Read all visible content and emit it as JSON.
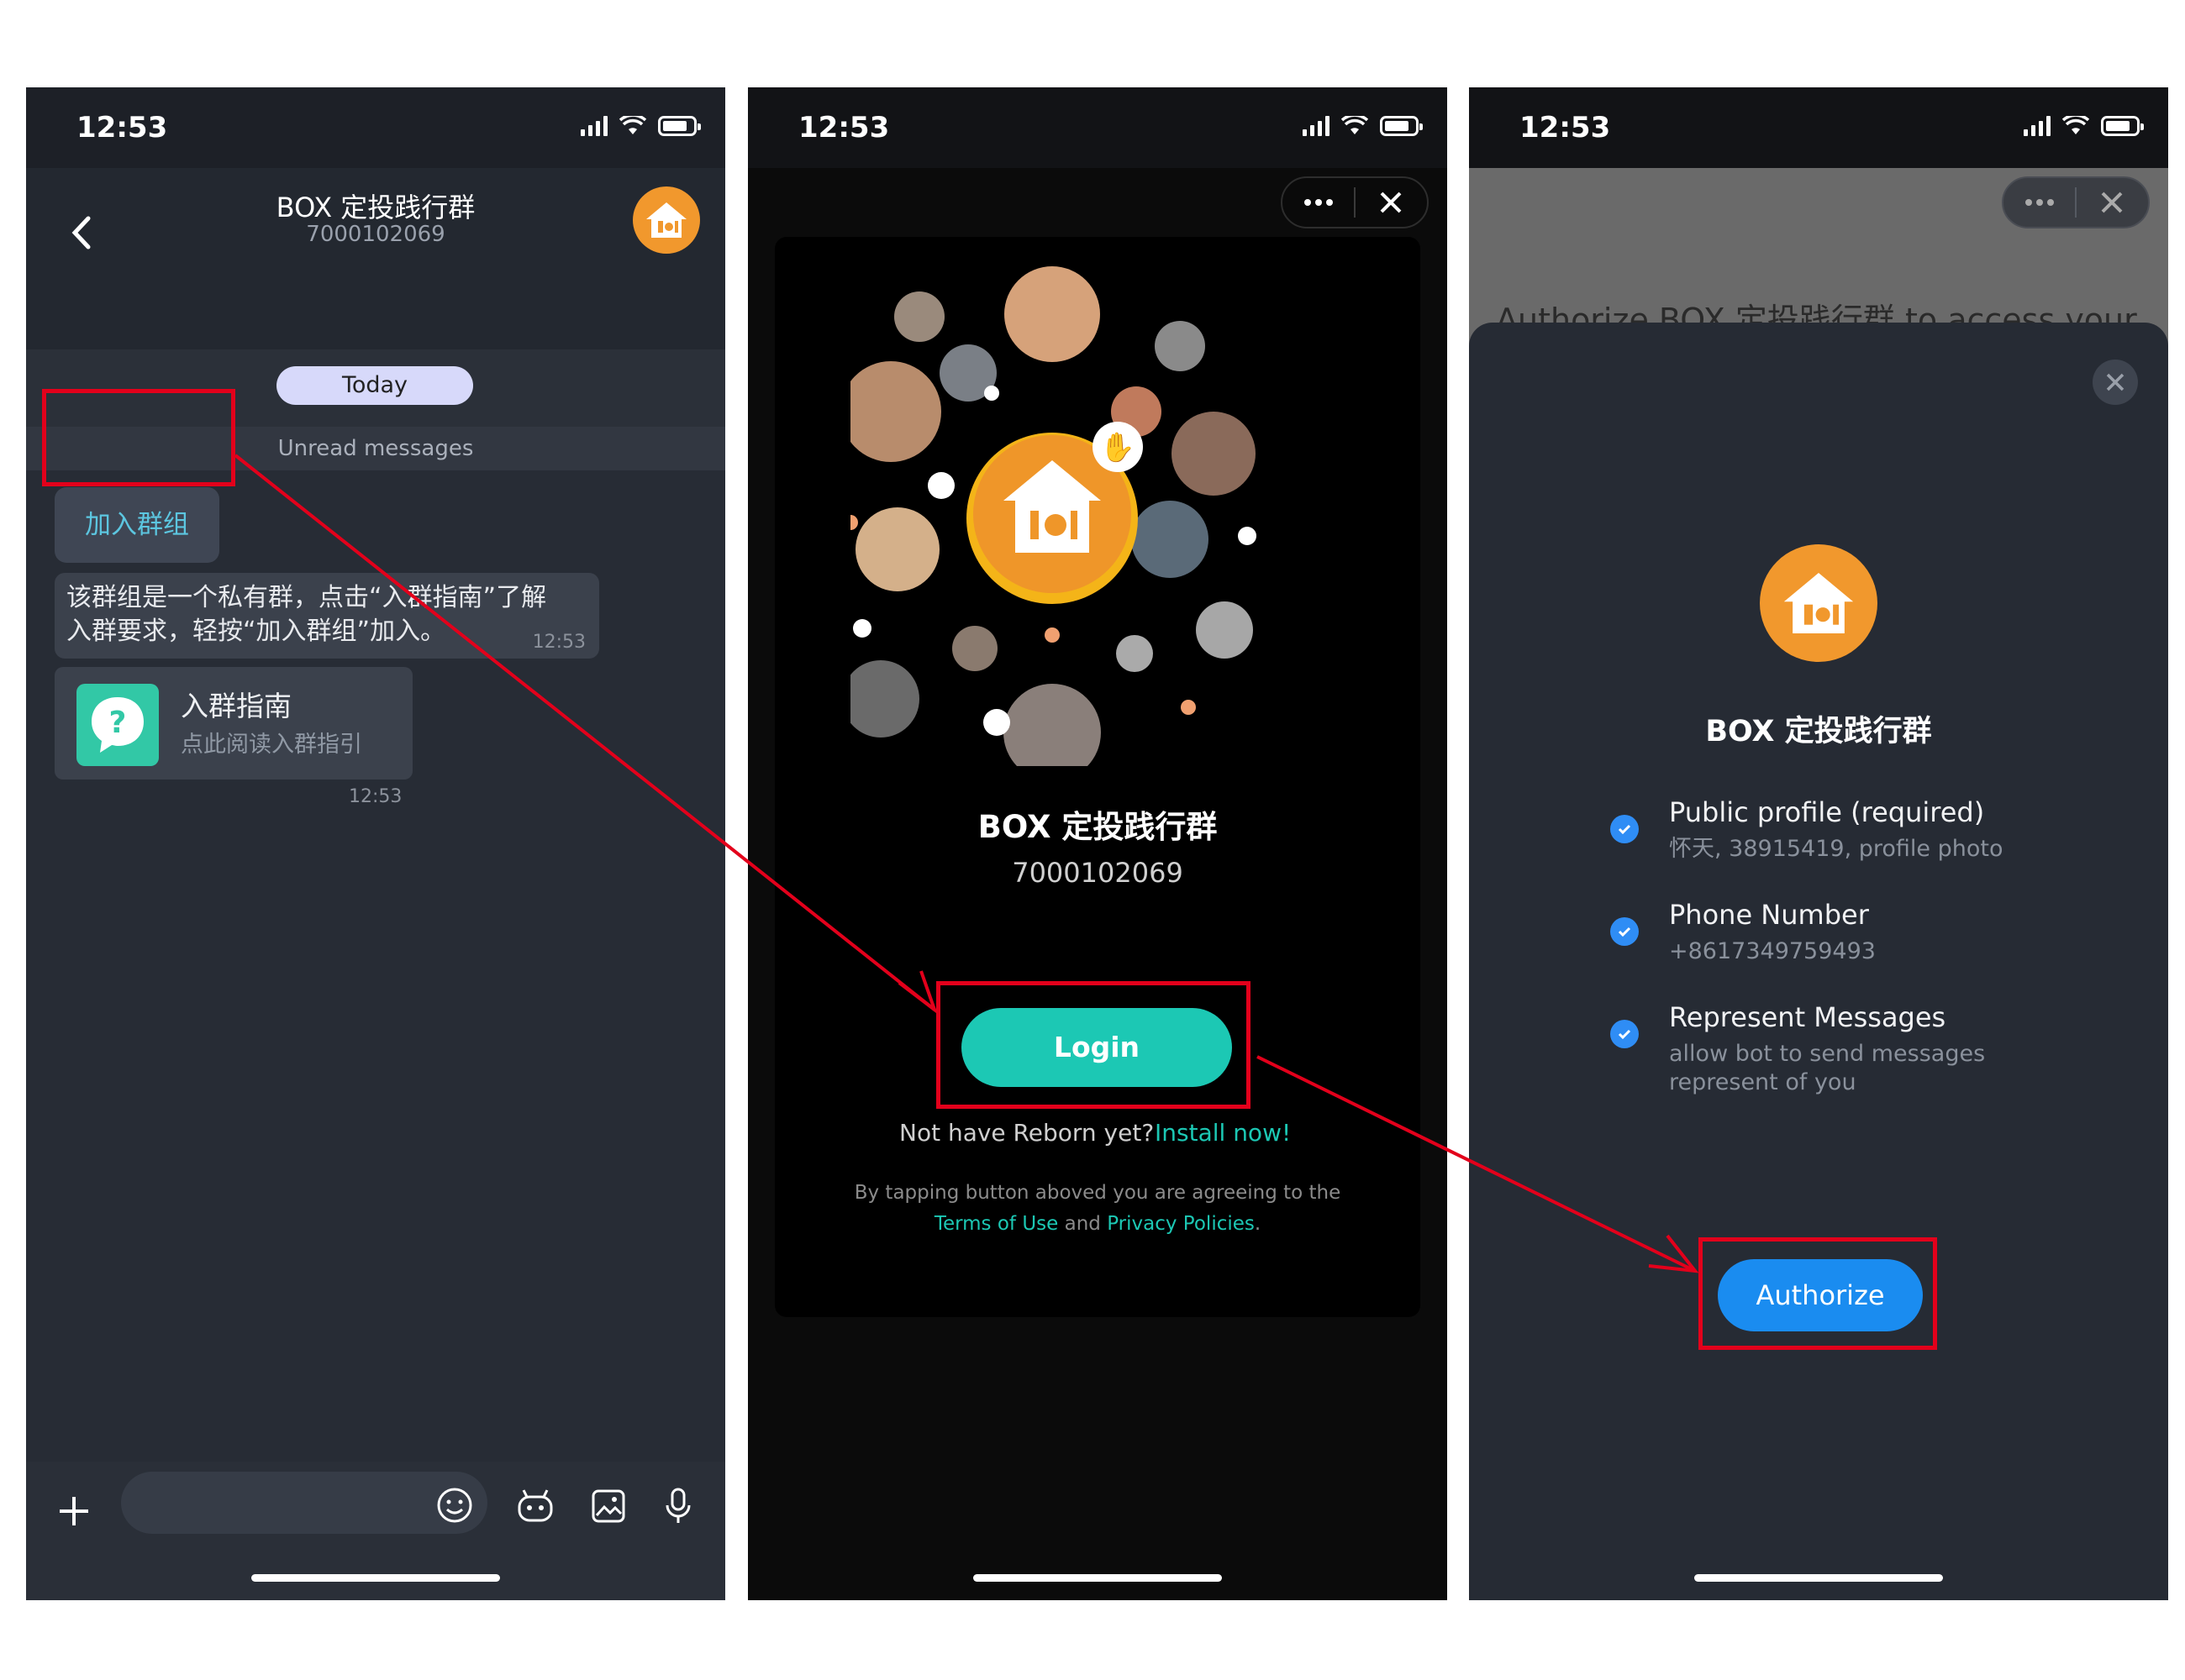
{
  "status": {
    "time": "12:53"
  },
  "chat": {
    "title": "BOX 定投践行群",
    "group_id": "7000102069",
    "date_label": "Today",
    "unread_label": "Unread messages",
    "join_button": "加入群组",
    "message_line1": "该群组是一个私有群，点击“入群指南”了解",
    "message_line2": "入群要求，轻按“加入群组”加入。",
    "message_time": "12:53",
    "card_title": "入群指南",
    "card_subtitle": "点此阅读入群指引",
    "card_time": "12:53"
  },
  "login": {
    "group_title": "BOX 定投践行群",
    "group_id": "7000102069",
    "login_button": "Login",
    "not_have_text": "Not have Reborn yet?",
    "install_link": "Install now!",
    "terms_prefix": "By tapping button aboved you are agreeing to the",
    "terms_link": "Terms of Use",
    "terms_and": "and",
    "privacy_link": "Privacy Policies",
    "terms_suffix": "."
  },
  "authorize": {
    "backdrop_text": "Authorize BOX 定投践行群 to access your",
    "title": "BOX 定投践行群",
    "permissions": [
      {
        "title": "Public profile (required)",
        "subtitle": "怀天, 38915419, profile photo"
      },
      {
        "title": "Phone Number",
        "subtitle": "+8617349759493"
      },
      {
        "title": "Represent Messages",
        "subtitle": "allow bot to send messages",
        "subtitle2": "represent of you"
      }
    ],
    "authorize_button": "Authorize"
  },
  "colors": {
    "accent_teal": "#1cc8b4",
    "accent_blue": "#1a8cf0",
    "brand_orange": "#f1982d",
    "annotation_red": "#e3001b"
  }
}
